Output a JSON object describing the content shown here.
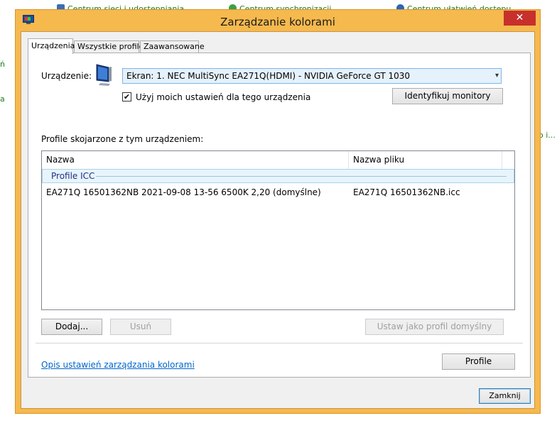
{
  "background": {
    "links": [
      {
        "label": "Centrum sieci i udostępniania"
      },
      {
        "label": "Centrum synchronizacji"
      },
      {
        "label": "Centrum ułatwień dostępu"
      }
    ],
    "fragments": [
      "ń",
      "a",
      "o i..."
    ]
  },
  "window": {
    "title": "Zarządzanie kolorami",
    "close_symbol": "✕"
  },
  "tabs": [
    {
      "label": "Urządzenia",
      "active": true
    },
    {
      "label": "Wszystkie profile",
      "active": false
    },
    {
      "label": "Zaawansowane",
      "active": false
    }
  ],
  "device": {
    "label": "Urządzenie:",
    "selected": "Ekran: 1. NEC MultiSync EA271Q(HDMI) - NVIDIA GeForce GT 1030",
    "dropdown_arrow": "▾",
    "checkbox_checked": true,
    "checkbox_mark": "✔",
    "checkbox_label": "Użyj moich ustawień dla tego urządzenia",
    "identify_button": "Identyfikuj monitory"
  },
  "profiles": {
    "section_label": "Profile skojarzone z tym urządzeniem:",
    "columns": [
      "Nazwa",
      "Nazwa pliku"
    ],
    "group_label": "Profile ICC",
    "rows": [
      {
        "name": "EA271Q 16501362NB 2021-09-08 13-56 6500K 2,20 (domyślne)",
        "file": "EA271Q 16501362NB.icc"
      }
    ]
  },
  "buttons": {
    "add": "Dodaj...",
    "remove": "Usuń",
    "set_default": "Ustaw jako profil domyślny",
    "profiles": "Profile",
    "close": "Zamknij"
  },
  "footer_link": "Opis ustawień zarządzania kolorami",
  "colors": {
    "window_frame": "#f6b94e",
    "close_button": "#c7302b",
    "link": "#0066cc"
  }
}
